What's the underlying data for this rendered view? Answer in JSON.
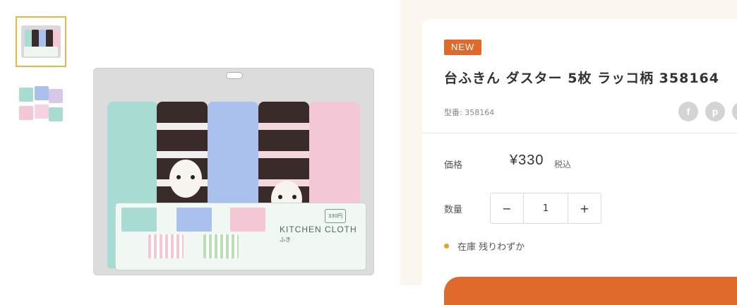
{
  "gallery": {
    "thumbnails": [
      {
        "name": "package-front",
        "active": true
      },
      {
        "name": "cloth-patterns",
        "active": false
      }
    ]
  },
  "product_image": {
    "card_title": "KITCHEN CLOTH",
    "card_sub": "ふき",
    "card_badge": "330円"
  },
  "product": {
    "badge": "NEW",
    "title": "台ふきん ダスター 5枚 ラッコ柄 358164",
    "model_label": "型番:",
    "model_number": "358164",
    "price_label": "価格",
    "price": "¥330",
    "tax_note": "税込",
    "quantity_label": "数量",
    "quantity_value": "1",
    "decrement_symbol": "−",
    "increment_symbol": "+",
    "stock_label": "在庫",
    "stock_status": "残りわずか"
  },
  "social": [
    {
      "icon": "facebook-icon",
      "glyph": "f"
    },
    {
      "icon": "pinterest-icon",
      "glyph": "p"
    },
    {
      "icon": "share-icon",
      "glyph": ""
    }
  ],
  "colors": {
    "accent": "#e06a2c",
    "stock_dot": "#e6a32c",
    "right_bg": "#fbf6ef",
    "thumb_border": "#e0b84e"
  }
}
